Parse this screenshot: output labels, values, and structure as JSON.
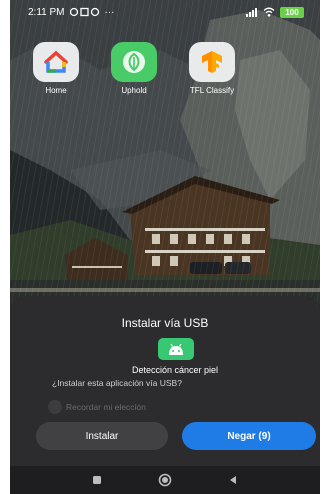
{
  "status": {
    "time": "2:11 PM",
    "dots": "···",
    "battery": "100"
  },
  "apps": [
    {
      "label": "Home",
      "icon": "google-home-icon"
    },
    {
      "label": "Uphold",
      "icon": "uphold-icon"
    },
    {
      "label": "TFL Classify",
      "icon": "tensorflow-icon"
    }
  ],
  "dialog": {
    "title": "Instalar vía USB",
    "app_name": "Detección cáncer piel",
    "question": "¿Instalar esta aplicación vía USB?",
    "remember_label": "Recordar mi elección",
    "install_label": "Instalar",
    "deny_label": "Negar (9)",
    "app_icon": "android-icon"
  },
  "navbar": {
    "icons": [
      "recent-apps-icon",
      "home-icon",
      "back-icon"
    ]
  },
  "colors": {
    "accent": "#1f7be6",
    "dialog_bg": "#2c2c2e",
    "app_icon_bg": "#38c873"
  }
}
